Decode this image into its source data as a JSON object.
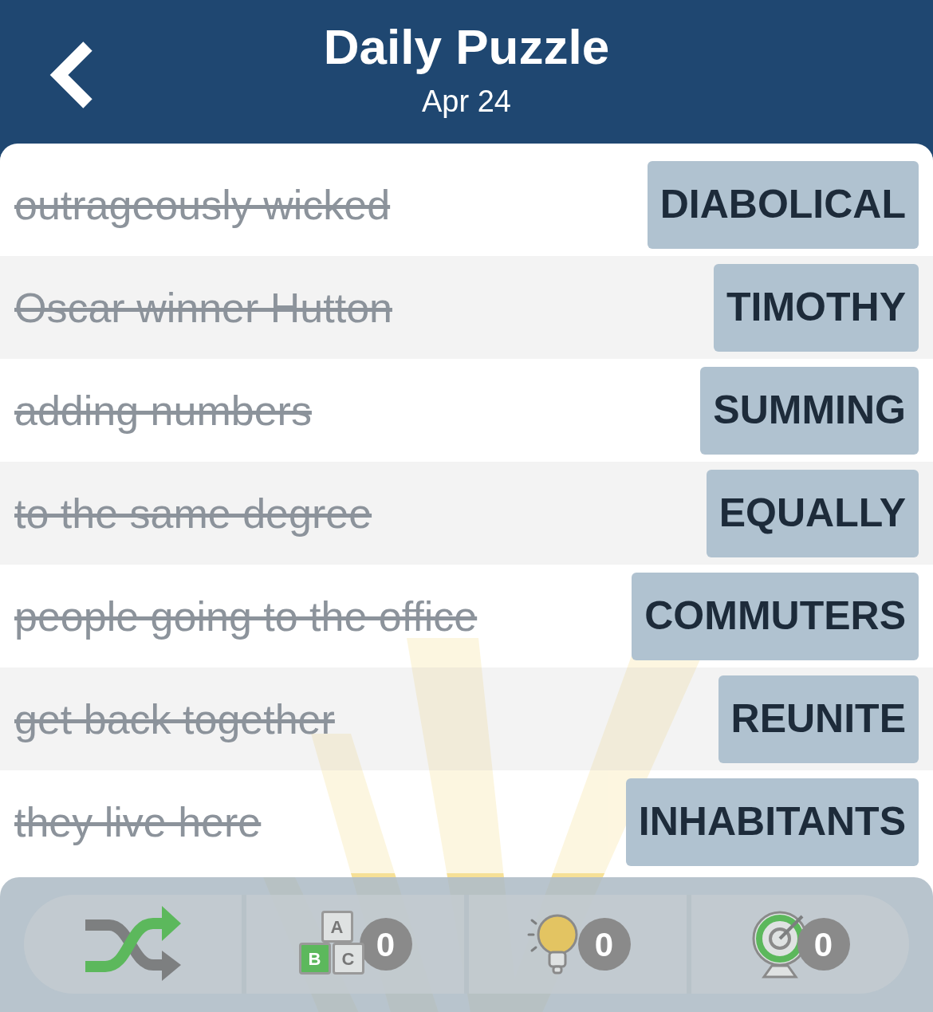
{
  "header": {
    "title": "Daily Puzzle",
    "subtitle": "Apr 24"
  },
  "rows": [
    {
      "clue": "outrageously wicked",
      "answer": "DIABOLICAL",
      "solved": true
    },
    {
      "clue": "Oscar winner Hutton",
      "answer": "TIMOTHY",
      "solved": true
    },
    {
      "clue": "adding numbers",
      "answer": "SUMMING",
      "solved": true
    },
    {
      "clue": "to the same degree",
      "answer": "EQUALLY",
      "solved": true
    },
    {
      "clue": "people going to the office",
      "answer": "COMMUTERS",
      "solved": true
    },
    {
      "clue": "get back together",
      "answer": "REUNITE",
      "solved": true
    },
    {
      "clue": "they live here",
      "answer": "INHABITANTS",
      "solved": true
    }
  ],
  "toolbar": [
    {
      "kind": "shuffle"
    },
    {
      "kind": "letters",
      "letters": [
        "A",
        "B",
        "C"
      ],
      "count": "0"
    },
    {
      "kind": "hint",
      "count": "0"
    },
    {
      "kind": "target",
      "count": "0"
    }
  ]
}
